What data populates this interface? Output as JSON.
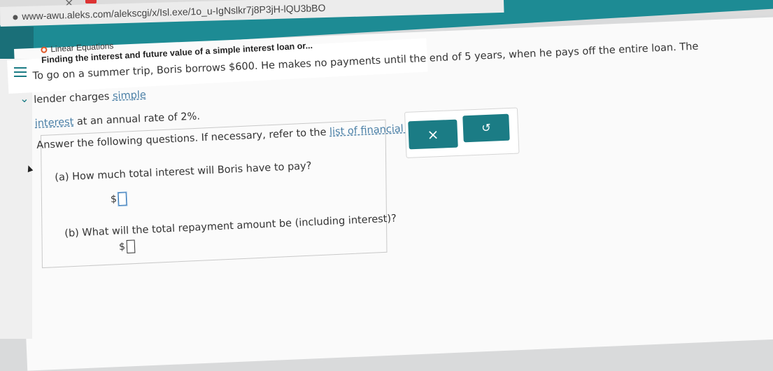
{
  "browser": {
    "url": "www-awu.aleks.com/alekscgi/x/Isl.exe/1o_u-IgNslkr7j8P3jH-lQU3bBO",
    "close_symbol": "×"
  },
  "header": {
    "topic": "Linear Equations",
    "subtitle": "Finding the interest and future value of a simple interest loan or..."
  },
  "problem": {
    "line1": "To go on a summer trip, Boris borrows $600. He makes no payments until the end of 5 years, when he pays off the entire loan. The lender charges ",
    "link_simple": "simple",
    "link_interest": "interest",
    "line2": " at an annual rate of 2%.",
    "instruction_prefix": "Answer the following questions. If necessary, refer to the ",
    "link_formulas": "list of financial formulas",
    "instruction_suffix": "."
  },
  "questions": {
    "a": "(a) How much total interest will Boris have to pay?",
    "b": "(b) What will the total repayment amount be (including interest)?",
    "currency": "$"
  },
  "tools": {
    "clear": "×",
    "undo": "↺"
  },
  "colors": {
    "accent": "#1b7c85",
    "topic_dot": "#e05a2a"
  }
}
